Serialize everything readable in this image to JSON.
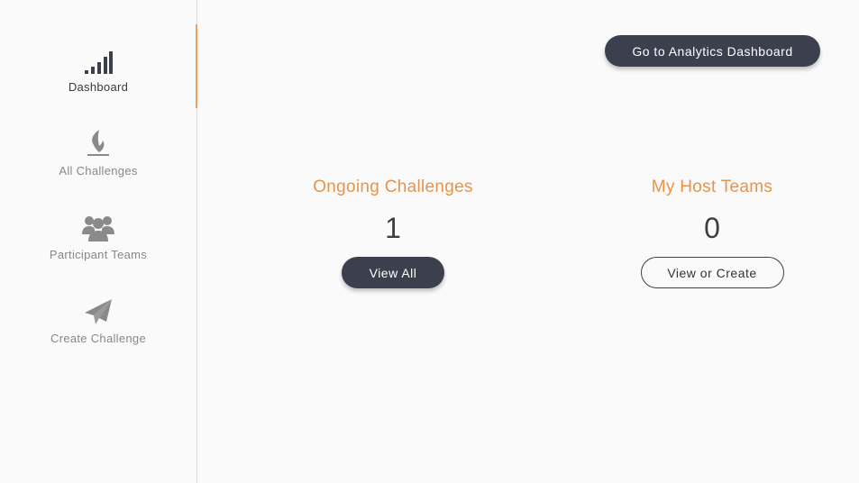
{
  "sidebar": {
    "items": [
      {
        "label": "Dashboard",
        "icon": "signal-bars-icon",
        "active": true
      },
      {
        "label": "All Challenges",
        "icon": "flame-icon",
        "active": false
      },
      {
        "label": "Participant Teams",
        "icon": "group-icon",
        "active": false
      },
      {
        "label": "Create Challenge",
        "icon": "paper-plane-icon",
        "active": false
      }
    ]
  },
  "header": {
    "analytics_button": "Go to Analytics Dashboard"
  },
  "stats": {
    "ongoing": {
      "title": "Ongoing Challenges",
      "count": "1",
      "button": "View All"
    },
    "host_teams": {
      "title": "My Host Teams",
      "count": "0",
      "button": "View or Create"
    }
  },
  "colors": {
    "accent": "#e8934a",
    "primary_dark": "#3c3f4e",
    "background": "#fafafa",
    "muted_text": "#888888"
  }
}
